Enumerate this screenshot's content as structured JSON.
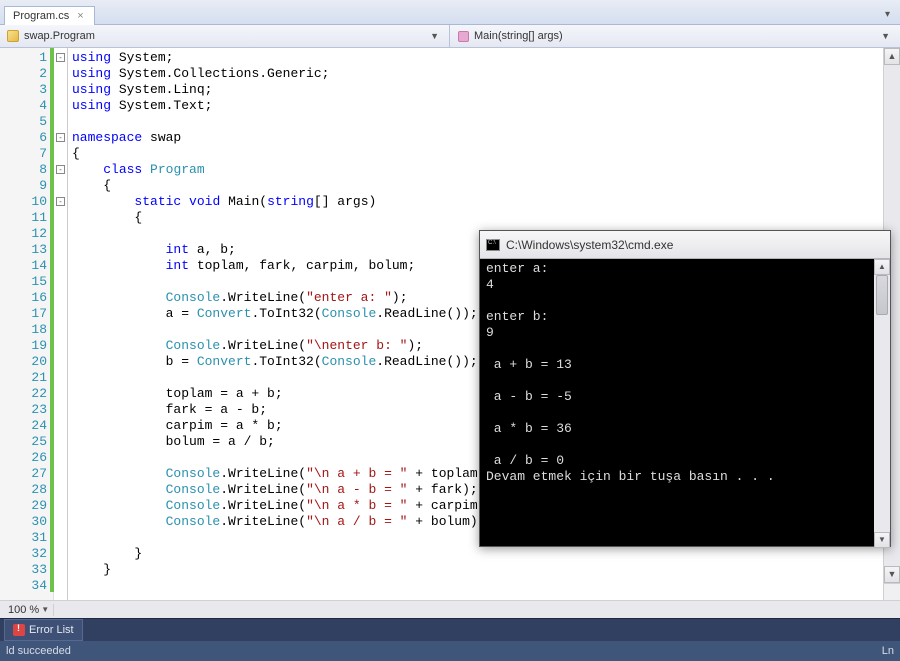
{
  "tab": {
    "label": "Program.cs",
    "close": "×"
  },
  "nav": {
    "left": "swap.Program",
    "right": "Main(string[] args)"
  },
  "zoom": "100 %",
  "bottom_tab": "Error List",
  "status": {
    "left": "ld succeeded",
    "right": "Ln"
  },
  "code": {
    "lines": [
      {
        "n": 1,
        "t": [
          {
            "c": "kw",
            "s": "using"
          },
          {
            "s": " System;"
          }
        ]
      },
      {
        "n": 2,
        "t": [
          {
            "c": "kw",
            "s": "using"
          },
          {
            "s": " System.Collections.Generic;"
          }
        ]
      },
      {
        "n": 3,
        "t": [
          {
            "c": "kw",
            "s": "using"
          },
          {
            "s": " System.Linq;"
          }
        ]
      },
      {
        "n": 4,
        "t": [
          {
            "c": "kw",
            "s": "using"
          },
          {
            "s": " System.Text;"
          }
        ]
      },
      {
        "n": 5,
        "t": []
      },
      {
        "n": 6,
        "t": [
          {
            "c": "kw",
            "s": "namespace"
          },
          {
            "s": " swap"
          }
        ]
      },
      {
        "n": 7,
        "t": [
          {
            "s": "{"
          }
        ]
      },
      {
        "n": 8,
        "t": [
          {
            "s": "    "
          },
          {
            "c": "kw",
            "s": "class"
          },
          {
            "s": " "
          },
          {
            "c": "type",
            "s": "Program"
          }
        ]
      },
      {
        "n": 9,
        "t": [
          {
            "s": "    {"
          }
        ]
      },
      {
        "n": 10,
        "t": [
          {
            "s": "        "
          },
          {
            "c": "kw",
            "s": "static"
          },
          {
            "s": " "
          },
          {
            "c": "kw",
            "s": "void"
          },
          {
            "s": " Main("
          },
          {
            "c": "kw",
            "s": "string"
          },
          {
            "s": "[] args)"
          }
        ]
      },
      {
        "n": 11,
        "t": [
          {
            "s": "        {"
          }
        ]
      },
      {
        "n": 12,
        "t": []
      },
      {
        "n": 13,
        "t": [
          {
            "s": "            "
          },
          {
            "c": "kw",
            "s": "int"
          },
          {
            "s": " a, b;"
          }
        ]
      },
      {
        "n": 14,
        "t": [
          {
            "s": "            "
          },
          {
            "c": "kw",
            "s": "int"
          },
          {
            "s": " toplam, fark, carpim, bolum;"
          }
        ]
      },
      {
        "n": 15,
        "t": []
      },
      {
        "n": 16,
        "t": [
          {
            "s": "            "
          },
          {
            "c": "type",
            "s": "Console"
          },
          {
            "s": ".WriteLine("
          },
          {
            "c": "str",
            "s": "\"enter a: \""
          },
          {
            "s": ");"
          }
        ]
      },
      {
        "n": 17,
        "t": [
          {
            "s": "            a = "
          },
          {
            "c": "type",
            "s": "Convert"
          },
          {
            "s": ".ToInt32("
          },
          {
            "c": "type",
            "s": "Console"
          },
          {
            "s": ".ReadLine());"
          }
        ]
      },
      {
        "n": 18,
        "t": []
      },
      {
        "n": 19,
        "t": [
          {
            "s": "            "
          },
          {
            "c": "type",
            "s": "Console"
          },
          {
            "s": ".WriteLine("
          },
          {
            "c": "str",
            "s": "\"\\nenter b: \""
          },
          {
            "s": ");"
          }
        ]
      },
      {
        "n": 20,
        "t": [
          {
            "s": "            b = "
          },
          {
            "c": "type",
            "s": "Convert"
          },
          {
            "s": ".ToInt32("
          },
          {
            "c": "type",
            "s": "Console"
          },
          {
            "s": ".ReadLine());"
          }
        ]
      },
      {
        "n": 21,
        "t": []
      },
      {
        "n": 22,
        "t": [
          {
            "s": "            toplam = a + b;"
          }
        ]
      },
      {
        "n": 23,
        "t": [
          {
            "s": "            fark = a - b;"
          }
        ]
      },
      {
        "n": 24,
        "t": [
          {
            "s": "            carpim = a * b;"
          }
        ]
      },
      {
        "n": 25,
        "t": [
          {
            "s": "            bolum = a / b;"
          }
        ]
      },
      {
        "n": 26,
        "t": []
      },
      {
        "n": 27,
        "t": [
          {
            "s": "            "
          },
          {
            "c": "type",
            "s": "Console"
          },
          {
            "s": ".WriteLine("
          },
          {
            "c": "str",
            "s": "\"\\n a + b = \""
          },
          {
            "s": " + toplam );"
          }
        ]
      },
      {
        "n": 28,
        "t": [
          {
            "s": "            "
          },
          {
            "c": "type",
            "s": "Console"
          },
          {
            "s": ".WriteLine("
          },
          {
            "c": "str",
            "s": "\"\\n a - b = \""
          },
          {
            "s": " + fark);"
          }
        ]
      },
      {
        "n": 29,
        "t": [
          {
            "s": "            "
          },
          {
            "c": "type",
            "s": "Console"
          },
          {
            "s": ".WriteLine("
          },
          {
            "c": "str",
            "s": "\"\\n a * b = \""
          },
          {
            "s": " + carpim);"
          }
        ]
      },
      {
        "n": 30,
        "t": [
          {
            "s": "            "
          },
          {
            "c": "type",
            "s": "Console"
          },
          {
            "s": ".WriteLine("
          },
          {
            "c": "str",
            "s": "\"\\n a / b = \""
          },
          {
            "s": " + bolum);"
          }
        ]
      },
      {
        "n": 31,
        "t": []
      },
      {
        "n": 32,
        "t": [
          {
            "s": "        }"
          }
        ]
      },
      {
        "n": 33,
        "t": [
          {
            "s": "    }"
          }
        ]
      },
      {
        "n": 34,
        "t": []
      }
    ]
  },
  "console": {
    "title": "C:\\Windows\\system32\\cmd.exe",
    "body": "enter a:\n4\n\nenter b:\n9\n\n a + b = 13\n\n a - b = -5\n\n a * b = 36\n\n a / b = 0\nDevam etmek için bir tuşa basın . . ."
  }
}
